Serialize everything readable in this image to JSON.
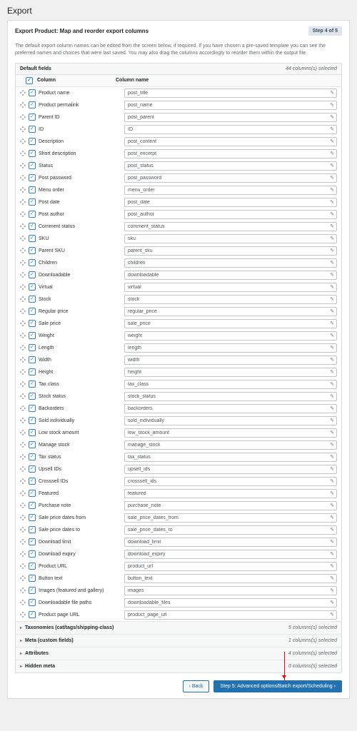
{
  "page_title": "Export",
  "panel_title": "Export Product: Map and reorder export columns",
  "step_badge": "Step 4 of 5",
  "description": "The default export column names can be edited from the screen below, if required. If you have chosen a pre-saved template you can see the preferred names and choices that were last saved. You may also drag the columns accordingly to reorder them within the output file.",
  "default_fields_label": "Default fields",
  "selected_summary": "44 columns(s) selected",
  "th_column": "Column",
  "th_column_name": "Column name",
  "rows": [
    {
      "label": "Product name",
      "value": "post_title"
    },
    {
      "label": "Product permalink",
      "value": "post_name"
    },
    {
      "label": "Parent ID",
      "value": "post_parent"
    },
    {
      "label": "ID",
      "value": "ID"
    },
    {
      "label": "Description",
      "value": "post_content"
    },
    {
      "label": "Short description",
      "value": "post_excerpt"
    },
    {
      "label": "Status",
      "value": "post_status"
    },
    {
      "label": "Post password",
      "value": "post_password"
    },
    {
      "label": "Menu order",
      "value": "menu_order"
    },
    {
      "label": "Post date",
      "value": "post_date"
    },
    {
      "label": "Post author",
      "value": "post_author"
    },
    {
      "label": "Comment status",
      "value": "comment_status"
    },
    {
      "label": "SKU",
      "value": "sku"
    },
    {
      "label": "Parent SKU",
      "value": "parent_sku"
    },
    {
      "label": "Children",
      "value": "children"
    },
    {
      "label": "Downloadable",
      "value": "downloadable"
    },
    {
      "label": "Virtual",
      "value": "virtual"
    },
    {
      "label": "Stock",
      "value": "stock"
    },
    {
      "label": "Regular price",
      "value": "regular_price"
    },
    {
      "label": "Sale price",
      "value": "sale_price"
    },
    {
      "label": "Weight",
      "value": "weight"
    },
    {
      "label": "Length",
      "value": "length"
    },
    {
      "label": "Width",
      "value": "width"
    },
    {
      "label": "Height",
      "value": "height"
    },
    {
      "label": "Tax class",
      "value": "tax_class"
    },
    {
      "label": "Stock status",
      "value": "stock_status"
    },
    {
      "label": "Backorders",
      "value": "backorders"
    },
    {
      "label": "Sold individually",
      "value": "sold_individually"
    },
    {
      "label": "Low stock amount",
      "value": "low_stock_amount"
    },
    {
      "label": "Manage stock",
      "value": "manage_stock"
    },
    {
      "label": "Tax status",
      "value": "tax_status"
    },
    {
      "label": "Upsell IDs",
      "value": "upsell_ids"
    },
    {
      "label": "Crosssell IDs",
      "value": "crosssell_ids"
    },
    {
      "label": "Featured",
      "value": "featured"
    },
    {
      "label": "Purchase note",
      "value": "purchase_note"
    },
    {
      "label": "Sale price dates from",
      "value": "sale_price_dates_from"
    },
    {
      "label": "Sale price dates to",
      "value": "sale_price_dates_to"
    },
    {
      "label": "Download limit",
      "value": "download_limit"
    },
    {
      "label": "Download expiry",
      "value": "download_expiry"
    },
    {
      "label": "Product URL",
      "value": "product_url"
    },
    {
      "label": "Button text",
      "value": "button_text"
    },
    {
      "label": "Images (featured and gallery)",
      "value": "images"
    },
    {
      "label": "Downloadable file paths",
      "value": "downloadable_files"
    },
    {
      "label": "Product page URL",
      "value": "product_page_url"
    }
  ],
  "accordions": [
    {
      "label": "Taxonomies (cat/tags/shipping-class)",
      "count": "5 columns(s) selected"
    },
    {
      "label": "Meta (custom fields)",
      "count": "1 columns(s) selected"
    },
    {
      "label": "Attributes",
      "count": "4 columns(s) selected"
    },
    {
      "label": "Hidden meta",
      "count": "0 columns(s) selected"
    }
  ],
  "back_label": "Back",
  "next_label": "Step 5: Advanced options/Batch export/Scheduling"
}
